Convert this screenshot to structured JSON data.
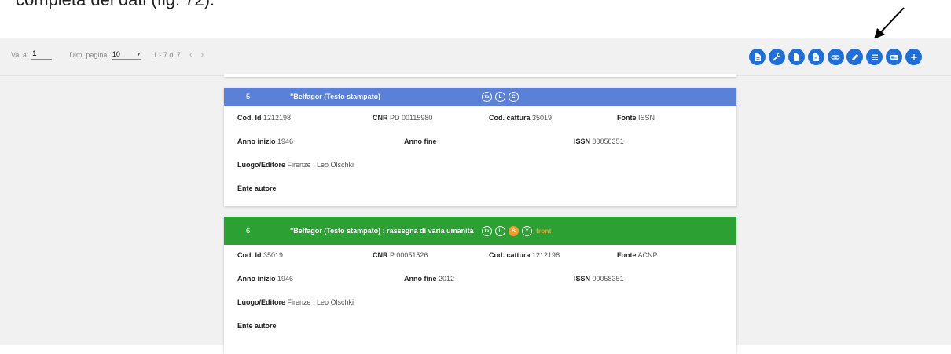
{
  "caption": "completa dei dati (fig. 72).",
  "pager": {
    "goto_label": "Vai a:",
    "goto_value": "1",
    "size_label": "Dim. pagina:",
    "size_value": "10",
    "range": "1 - 7 di 7",
    "prev_icon": "chevron-left-icon",
    "next_icon": "chevron-right-icon"
  },
  "actions": [
    {
      "icon": "document-icon"
    },
    {
      "icon": "wrench-icon"
    },
    {
      "icon": "file-icon"
    },
    {
      "icon": "file-text-icon"
    },
    {
      "icon": "link-icon"
    },
    {
      "icon": "pencil-icon"
    },
    {
      "icon": "list-icon"
    },
    {
      "icon": "card-icon"
    },
    {
      "icon": "plus-icon"
    }
  ],
  "colors": {
    "accent": "#1e6fd9",
    "card_blue": "#5b80d8",
    "card_green": "#2ba033",
    "badge_orange": "#f39c2c"
  },
  "cards": [
    {
      "number": "5",
      "title": "\"Belfagor (Testo stampato)",
      "badges": [
        "ta",
        "L",
        "C"
      ],
      "badge_text": "",
      "cod_id_label": "Cod. Id",
      "cod_id": "1212198",
      "cnr_label": "CNR",
      "cnr": "PD 00115980",
      "cod_cattura_label": "Cod. cattura",
      "cod_cattura": "35019",
      "fonte_label": "Fonte",
      "fonte": "ISSN",
      "anno_inizio_label": "Anno inizio",
      "anno_inizio": "1946",
      "anno_fine_label": "Anno fine",
      "anno_fine": "",
      "issn_label": "ISSN",
      "issn": "00058351",
      "luogo_label": "Luogo/Editore",
      "luogo": "Firenze : Leo Olschki",
      "ente_label": "Ente autore",
      "ente": ""
    },
    {
      "number": "6",
      "title": "\"Belfagor (Testo stampato) : rassegna di varia umanità",
      "badges": [
        "ta",
        "L",
        "S",
        "Y"
      ],
      "badge_text": "front",
      "cod_id_label": "Cod. Id",
      "cod_id": "35019",
      "cnr_label": "CNR",
      "cnr": "P 00051526",
      "cod_cattura_label": "Cod. cattura",
      "cod_cattura": "1212198",
      "fonte_label": "Fonte",
      "fonte": "ACNP",
      "anno_inizio_label": "Anno inizio",
      "anno_inizio": "1946",
      "anno_fine_label": "Anno fine",
      "anno_fine": "2012",
      "issn_label": "ISSN",
      "issn": "00058351",
      "luogo_label": "Luogo/Editore",
      "luogo": "Firenze : Leo Olschki",
      "ente_label": "Ente autore",
      "ente": ""
    }
  ]
}
